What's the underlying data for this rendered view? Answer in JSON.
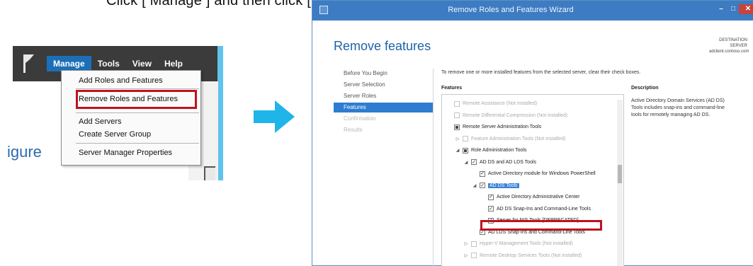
{
  "caption": {
    "top_text": "Click [ Manage ] and then click [ Remove Roles and Features ]"
  },
  "server_manager": {
    "menu": [
      "Manage",
      "Tools",
      "View",
      "Help"
    ],
    "active_menu_index": 0,
    "dropdown": [
      "Add Roles and Features",
      "Remove Roles and Features",
      "Add Servers",
      "Create Server Group",
      "Server Manager Properties"
    ],
    "highlighted_item_index": 1,
    "background_text": "igure"
  },
  "wizard": {
    "window_title": "Remove Roles and Features Wizard",
    "heading": "Remove features",
    "destination": {
      "label": "DESTINATION SERVER",
      "server": "adclient.contoso.com"
    },
    "nav": [
      {
        "label": "Before You Begin",
        "state": "normal"
      },
      {
        "label": "Server Selection",
        "state": "normal"
      },
      {
        "label": "Server Roles",
        "state": "normal"
      },
      {
        "label": "Features",
        "state": "active"
      },
      {
        "label": "Confirmation",
        "state": "disabled"
      },
      {
        "label": "Results",
        "state": "disabled"
      }
    ],
    "instruction": "To remove one or more installed features from the selected server, clear their check boxes.",
    "features_header": "Features",
    "description_header": "Description",
    "description_text": "Active Directory Domain Services (AD DS) Tools includes snap-ins and command-line tools for remotely managing AD DS.",
    "tree": [
      {
        "label": "Remote Assistance (Not installed)",
        "indent": 0,
        "expander": "",
        "check": "empty",
        "disabled": true
      },
      {
        "label": "Remote Differential Compression (Not installed)",
        "indent": 0,
        "expander": "",
        "check": "empty",
        "disabled": true
      },
      {
        "label": "Remote Server Administration Tools",
        "indent": 0,
        "expander": "",
        "check": "mixed",
        "disabled": false
      },
      {
        "label": "Feature Administration Tools (Not installed)",
        "indent": 1,
        "expander": "▷",
        "check": "empty",
        "disabled": true
      },
      {
        "label": "Role Administration Tools",
        "indent": 1,
        "expander": "◢",
        "check": "mixed",
        "disabled": false
      },
      {
        "label": "AD DS and AD LDS Tools",
        "indent": 2,
        "expander": "◢",
        "check": "checked",
        "disabled": false
      },
      {
        "label": "Active Directory module for Windows PowerShell",
        "indent": 3,
        "expander": "",
        "check": "checked",
        "disabled": false
      },
      {
        "label": "AD DS Tools",
        "indent": 3,
        "expander": "◢",
        "check": "checked",
        "disabled": false,
        "selected": true
      },
      {
        "label": "Active Directory Administrative Center",
        "indent": 4,
        "expander": "",
        "check": "checked",
        "disabled": false
      },
      {
        "label": "AD DS Snap-Ins and Command-Line Tools",
        "indent": 4,
        "expander": "",
        "check": "checked",
        "disabled": false
      },
      {
        "label": "Server for NIS Tools [DEPRECATED]",
        "indent": 4,
        "expander": "",
        "check": "checked",
        "disabled": false
      },
      {
        "label": "AD LDS Snap-Ins and Command-Line Tools",
        "indent": 3,
        "expander": "",
        "check": "checked",
        "disabled": false
      },
      {
        "label": "Hyper-V Management Tools (Not installed)",
        "indent": 2,
        "expander": "▷",
        "check": "empty",
        "disabled": true
      },
      {
        "label": "Remote Desktop Services Tools (Not installed)",
        "indent": 2,
        "expander": "▷",
        "check": "empty",
        "disabled": true
      }
    ]
  },
  "colors": {
    "highlight_red": "#c0121d",
    "accent_blue": "#2e7dd0",
    "arrow_cyan": "#1fb5e8"
  }
}
